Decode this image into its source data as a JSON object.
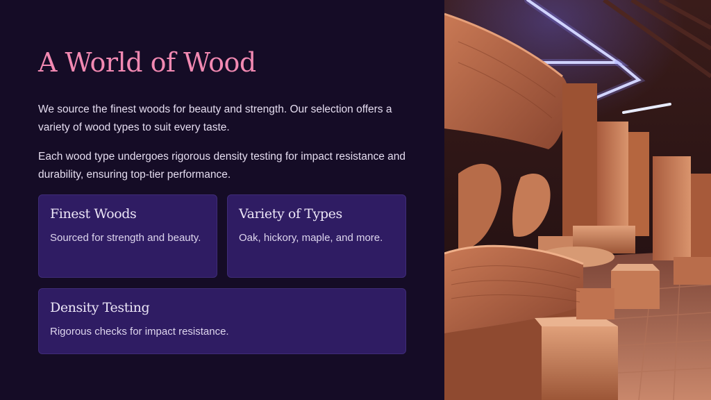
{
  "slide": {
    "title": "A World of Wood",
    "paragraphs": [
      "We source the finest woods for beauty and strength. Our selection offers a variety of wood types to suit every taste.",
      "Each wood type undergoes rigorous density testing for impact resistance and durability, ensuring top-tier performance."
    ],
    "cards": [
      {
        "title": "Finest Woods",
        "text": "Sourced for strength and beauty."
      },
      {
        "title": "Variety of Types",
        "text": "Oak, hickory, maple, and more."
      },
      {
        "title": "Density Testing",
        "text": "Rigorous checks for impact resistance."
      }
    ]
  },
  "colors": {
    "background": "#150c26",
    "title": "#f289b2",
    "card": "#2f1c63",
    "text": "#e5ddf0"
  }
}
